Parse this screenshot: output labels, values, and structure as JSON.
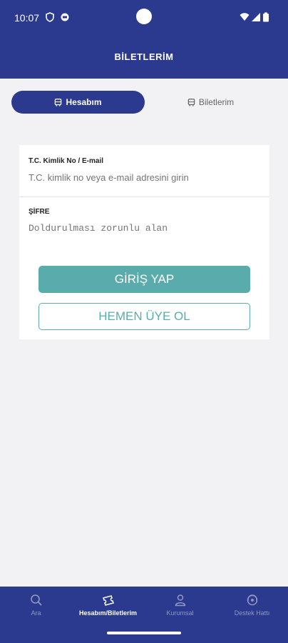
{
  "status_bar": {
    "time": "10:07"
  },
  "header": {
    "title": "BİLETLERİM"
  },
  "tabs": [
    {
      "label": "Hesabım",
      "icon": "bus-icon",
      "active": true
    },
    {
      "label": "Biletlerim",
      "icon": "bus-icon",
      "active": false
    }
  ],
  "form": {
    "tc_label": "T.C. Kimlik No / E-mail",
    "tc_placeholder": "T.C. kimlik no veya e-mail adresini girin",
    "password_label": "ŞİFRE",
    "password_placeholder": "Doldurulması zorunlu alan",
    "login_label": "GİRİŞ YAP",
    "signup_label": "HEMEN ÜYE OL"
  },
  "bottom_nav": [
    {
      "label": "Ara",
      "icon": "search-icon",
      "active": false
    },
    {
      "label": "Hesabım/Biletlerim",
      "icon": "ticket-icon",
      "active": true
    },
    {
      "label": "Kurumsal",
      "icon": "person-icon",
      "active": false
    },
    {
      "label": "Destek Hattı",
      "icon": "support-icon",
      "active": false
    }
  ],
  "colors": {
    "primary": "#2b3a8f",
    "accent": "#5aacac",
    "background": "#f2f2f4"
  }
}
